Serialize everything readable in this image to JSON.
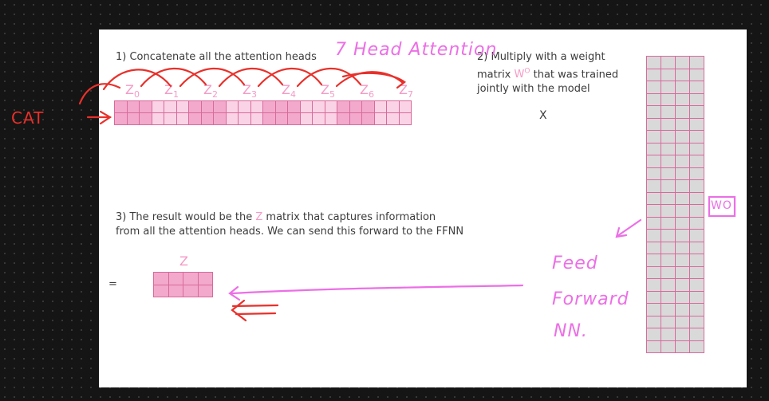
{
  "step1": {
    "text": "1) Concatenate all the attention heads"
  },
  "step2": {
    "line1": "2) Multiply with a weight",
    "line2_prefix": "matrix ",
    "wo": "W",
    "wo_sup": "O",
    "line2_suffix": " that was trained",
    "line3": "jointly with the model"
  },
  "step3": {
    "line1_prefix": "3) The result would be the ",
    "z": "Z",
    "line1_suffix": " matrix that captures information",
    "line2": "from all the attention heads. We can send this forward to the FFNN"
  },
  "multiply_sign": "X",
  "equals_sign": "=",
  "heads": [
    {
      "label": "Z",
      "sub": "0"
    },
    {
      "label": "Z",
      "sub": "1"
    },
    {
      "label": "Z",
      "sub": "2"
    },
    {
      "label": "Z",
      "sub": "3"
    },
    {
      "label": "Z",
      "sub": "4"
    },
    {
      "label": "Z",
      "sub": "5"
    },
    {
      "label": "Z",
      "sub": "6"
    },
    {
      "label": "Z",
      "sub": "7"
    }
  ],
  "result_label": "Z",
  "annotations": {
    "cat": "CAT",
    "head_attention": "7 Head Attention",
    "feed": "Feed",
    "forward": "Forward",
    "nn": "NN.",
    "wo_box": "WO"
  },
  "colors": {
    "pink_dark": "#f2a9cc",
    "pink_light": "#fad3e6",
    "pink_text": "#f59ac6",
    "weight_fill": "#d9d9d9",
    "grid_line": "#d86a9a",
    "red_ink": "#e8302a",
    "magenta_ink": "#ec6fe6"
  }
}
